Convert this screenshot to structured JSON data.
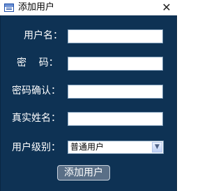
{
  "window": {
    "title": "添加用户",
    "close_glyph": "✕"
  },
  "form": {
    "username_label": "用户名：",
    "password_label": "密    码：",
    "confirm_label": "密码确认：",
    "realname_label": "真实姓名：",
    "level_label": "用户级别：",
    "username_value": "",
    "password_value": "",
    "confirm_value": "",
    "realname_value": "",
    "level_selected": "普通用户",
    "dropdown_glyph": "▼",
    "submit_label": "添加用户"
  },
  "colors": {
    "panel_background": "#0e3254",
    "button_background": "#5a6f87"
  },
  "icons": {
    "app": "app-window-icon",
    "close": "close-icon",
    "dropdown": "chevron-down-icon"
  }
}
